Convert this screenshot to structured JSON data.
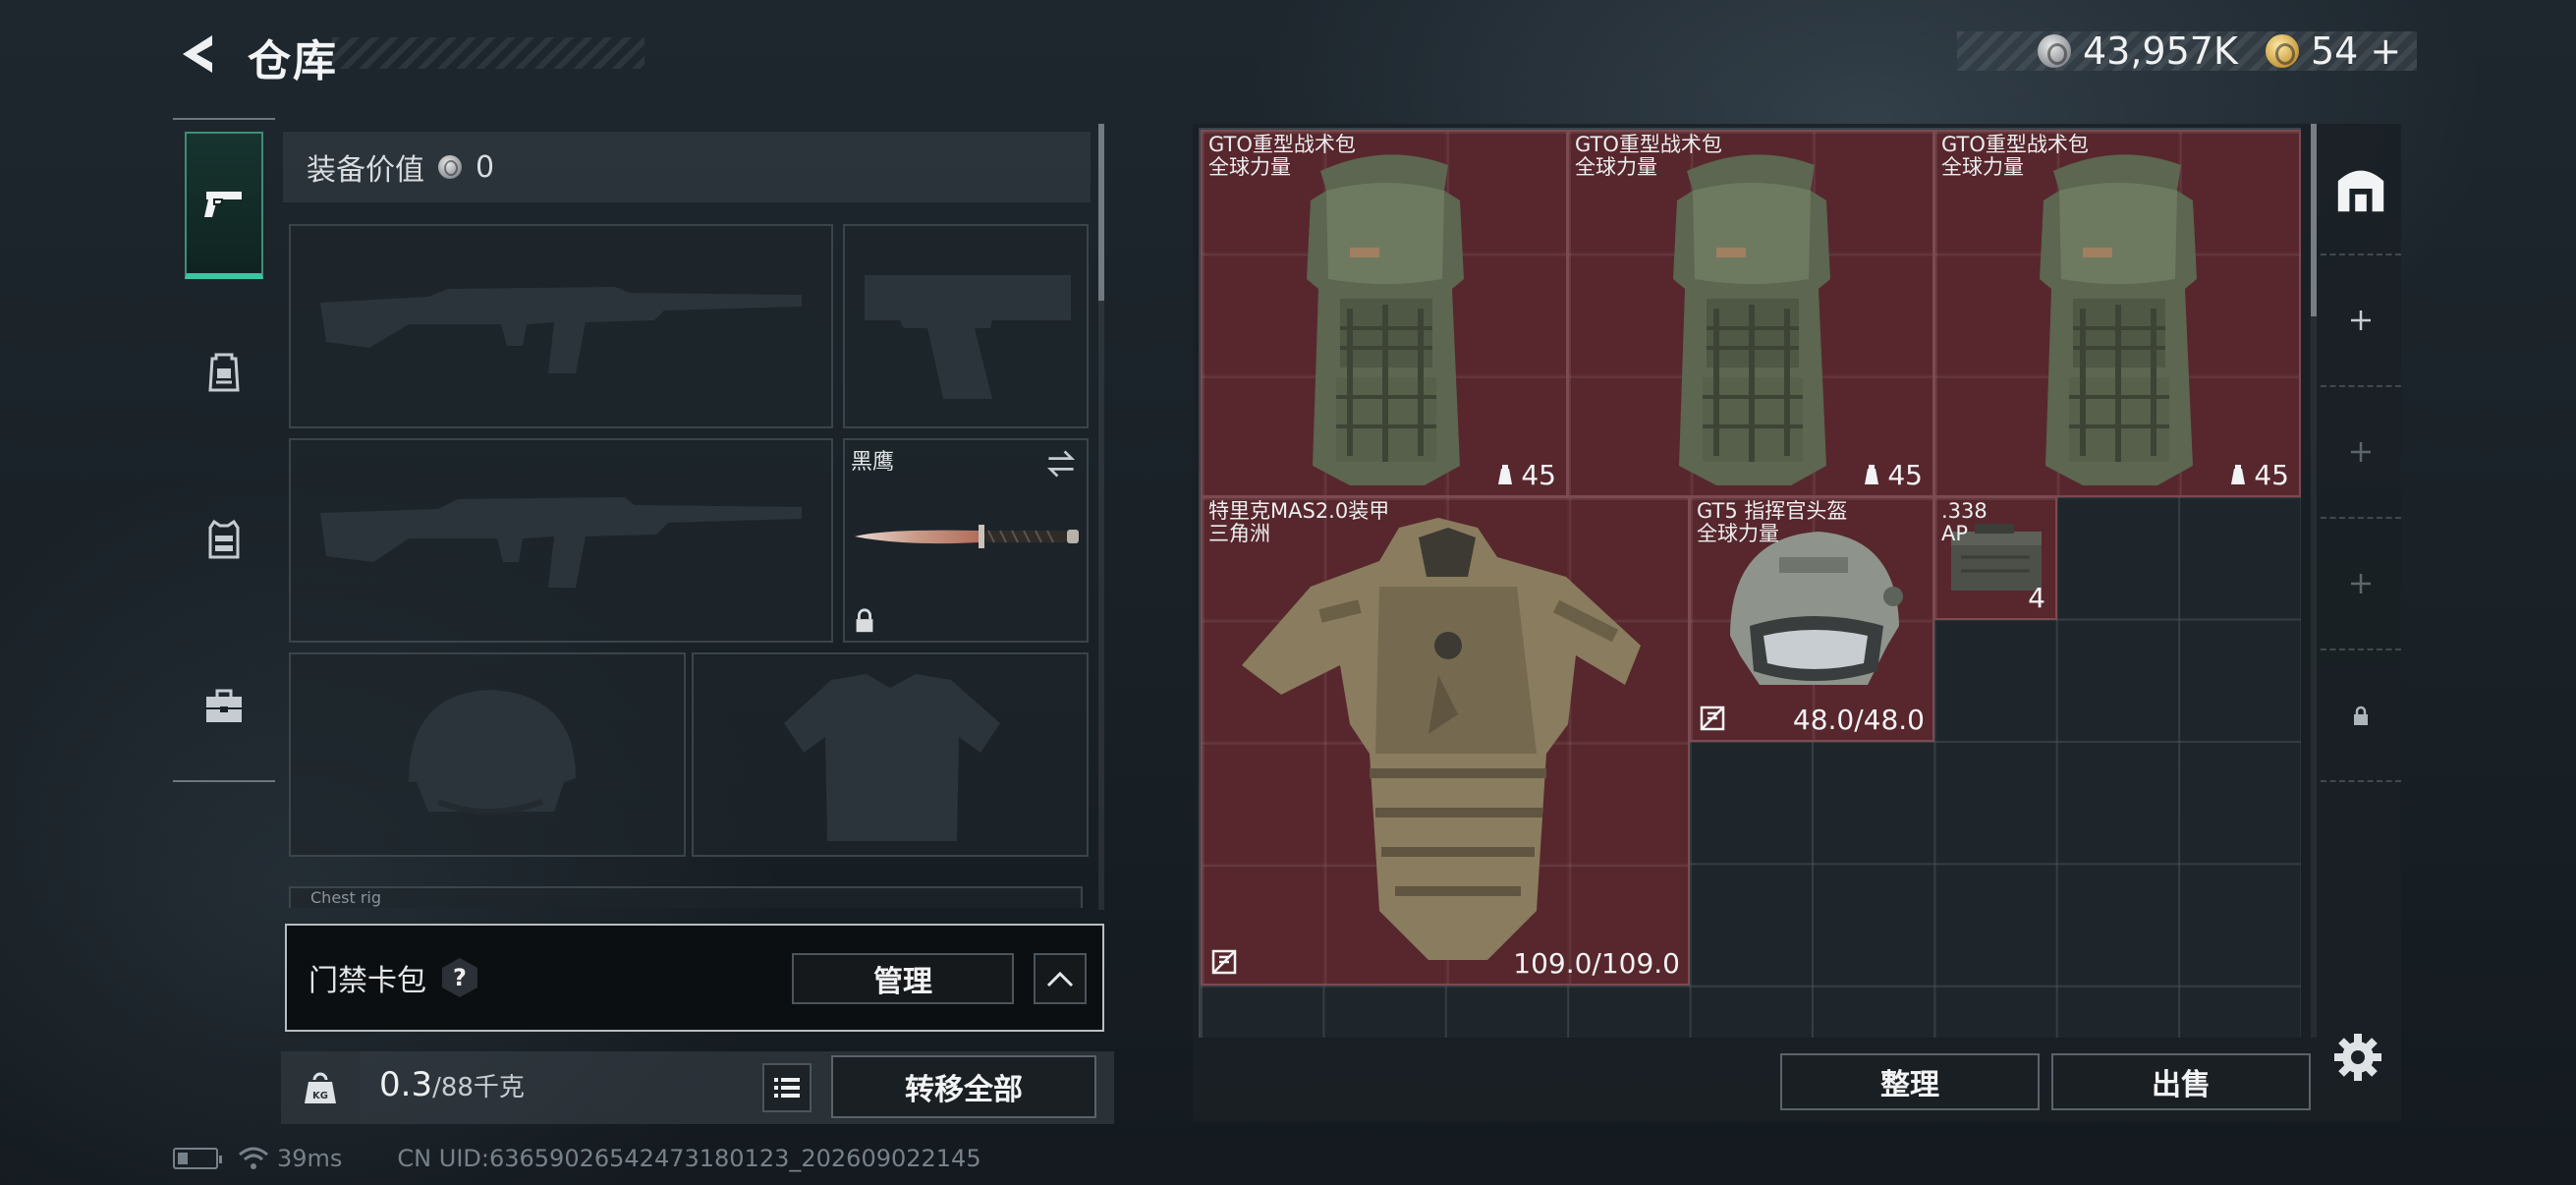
{
  "header": {
    "title": "仓库",
    "silver": "43,957K",
    "gold": "54",
    "gold_add": "+"
  },
  "left_tabs": [
    {
      "name": "weapons",
      "icon": "pistol-icon",
      "active": true
    },
    {
      "name": "backpack",
      "icon": "backpack-icon",
      "active": false
    },
    {
      "name": "vest",
      "icon": "chest-rig-icon",
      "active": false
    },
    {
      "name": "case",
      "icon": "briefcase-icon",
      "active": false
    }
  ],
  "loadout": {
    "equip_value_label": "装备价值",
    "equip_value": "0",
    "melee_label": "黑鹰",
    "partial_slot_label": "Chest rig"
  },
  "keycard": {
    "label": "门禁卡包",
    "help": "?",
    "manage": "管理"
  },
  "weight": {
    "current": "0.3",
    "max": "/88千克",
    "transfer_all": "转移全部"
  },
  "status_bar": {
    "ping": "39ms",
    "uid": "CN UID:63659026542473180123_202609022145"
  },
  "stash": {
    "items": [
      {
        "name": "GTO重型战术包",
        "sub": "全球力量",
        "count": "45"
      },
      {
        "name": "GTO重型战术包",
        "sub": "全球力量",
        "count": "45"
      },
      {
        "name": "GTO重型战术包",
        "sub": "全球力量",
        "count": "45"
      },
      {
        "name": "特里克MAS2.0装甲",
        "sub": "三角洲",
        "durability": "109.0/109.0"
      },
      {
        "name": "GT5 指挥官头盔",
        "sub": "全球力量",
        "durability": "48.0/48.0"
      },
      {
        "name": ".338",
        "sub": "AP",
        "count": "4"
      }
    ],
    "sort": "整理",
    "sell": "出售"
  },
  "rail": [
    {
      "icon": "stash-home-icon"
    },
    {
      "icon": "plus-icon"
    },
    {
      "icon": "plus-icon"
    },
    {
      "icon": "plus-icon"
    },
    {
      "icon": "lock-icon"
    }
  ],
  "colors": {
    "accent": "#39c6a1",
    "item_bg": "#68282e",
    "panel": "#1f262b"
  }
}
